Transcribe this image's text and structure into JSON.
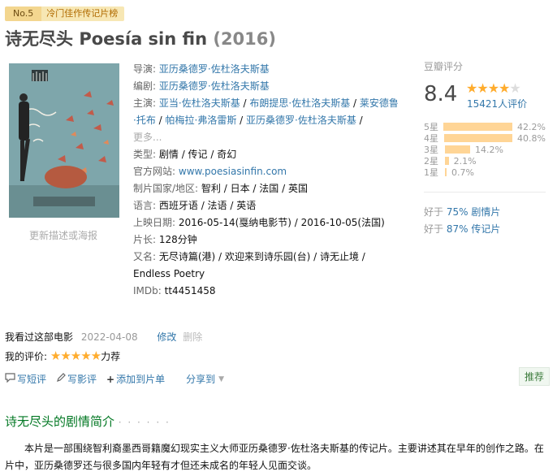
{
  "badge": {
    "no": "No.5",
    "label": "冷门佳作传记片榜"
  },
  "title": {
    "cn": "诗无尽头",
    "original": "Poesía sin fin",
    "year": "(2016)"
  },
  "poster": {
    "caption": "更新描述或海报"
  },
  "info": {
    "director_label": "导演:",
    "director": "亚历桑德罗·佐杜洛夫斯基",
    "writer_label": "编剧:",
    "writer": "亚历桑德罗·佐杜洛夫斯基",
    "cast_label": "主演:",
    "cast": [
      "亚当·佐杜洛夫斯基",
      "布朗提思·佐杜洛夫斯基",
      "莱安德鲁·托布",
      "帕梅拉·弗洛雷斯",
      "亚历桑德罗·佐杜洛夫斯基"
    ],
    "cast_more": "更多...",
    "genre_label": "类型:",
    "genre": "剧情 / 传记 / 奇幻",
    "site_label": "官方网站:",
    "site": "www.poesiasinfin.com",
    "country_label": "制片国家/地区:",
    "country": "智利 / 日本 / 法国 / 英国",
    "lang_label": "语言:",
    "lang": "西班牙语 / 法语 / 英语",
    "release_label": "上映日期:",
    "release": "2016-05-14(戛纳电影节) / 2016-10-05(法国)",
    "runtime_label": "片长:",
    "runtime": "128分钟",
    "aka_label": "又名:",
    "aka_line1": "无尽诗篇(港) / 欢迎来到诗乐园(台) / 诗无止境 /",
    "aka_line2": "Endless Poetry",
    "imdb_label": "IMDb:",
    "imdb": "tt4451458"
  },
  "rating": {
    "title": "豆瓣评分",
    "score": "8.4",
    "stars": 4.0,
    "votes": "15421人评价",
    "distribution": [
      {
        "star": "5星",
        "pct": "42.2%",
        "value": 42.2
      },
      {
        "star": "4星",
        "pct": "40.8%",
        "value": 40.8
      },
      {
        "star": "3星",
        "pct": "14.2%",
        "value": 14.2
      },
      {
        "star": "2星",
        "pct": "2.1%",
        "value": 2.1
      },
      {
        "star": "1星",
        "pct": "0.7%",
        "value": 0.7
      }
    ],
    "better1_prefix": "好于",
    "better1_link": "75% 剧情片",
    "better2_prefix": "好于",
    "better2_link": "87% 传记片"
  },
  "mine": {
    "watched": "我看过这部电影",
    "date": "2022-04-08",
    "edit": "修改",
    "delete": "删除",
    "rate_label": "我的评价:",
    "rate_stars": "★★★★★",
    "rate_text": "力荐"
  },
  "actions": {
    "comment": "写短评",
    "review": "写影评",
    "add_list": "添加到片单",
    "share": "分享到",
    "recommend": "推荐"
  },
  "section": {
    "title": "诗无尽头的剧情简介",
    "dots": "· · · · · ·"
  },
  "summary": "本片是一部围绕智利裔墨西哥籍魔幻现实主义大师亚历桑德罗·佐杜洛夫斯基的传记片。主要讲述其在早年的创作之路。在片中，亚历桑德罗还与很多国内年轻有才但还未成名的年轻人见面交谈。"
}
